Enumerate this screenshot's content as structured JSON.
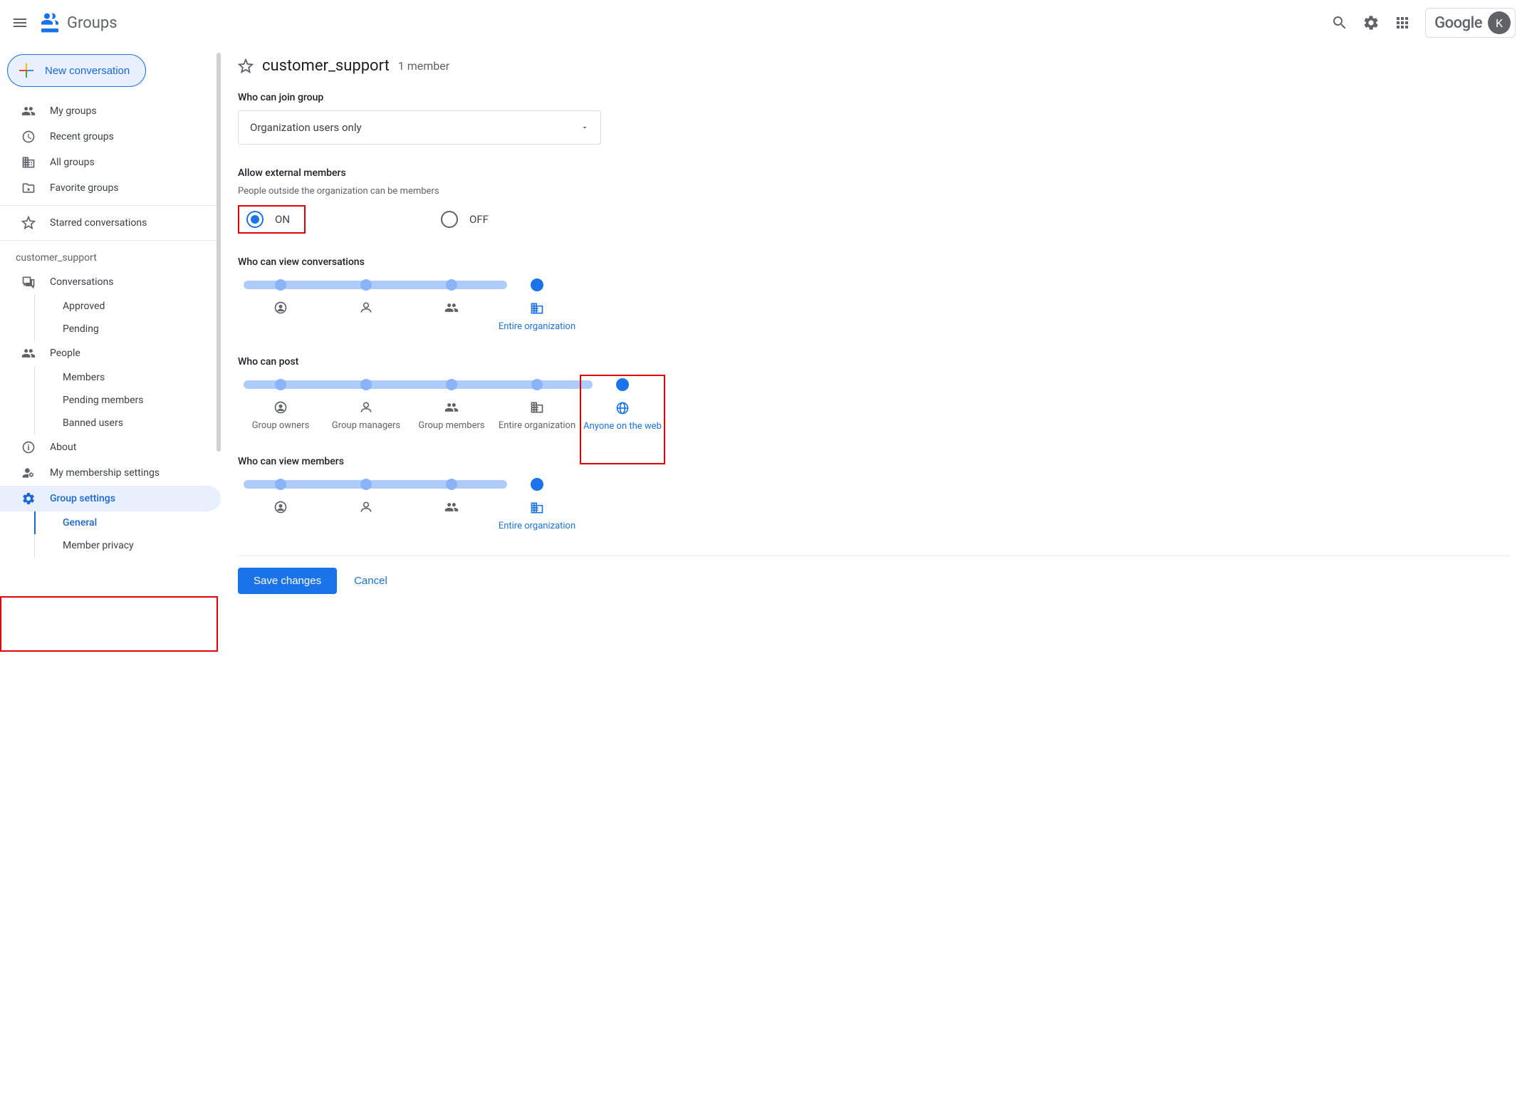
{
  "header": {
    "app_name": "Groups",
    "brand": "Google",
    "avatar_initial": "K"
  },
  "sidebar": {
    "new_conversation": "New conversation",
    "items": {
      "my_groups": "My groups",
      "recent_groups": "Recent groups",
      "all_groups": "All groups",
      "favorite_groups": "Favorite groups",
      "starred": "Starred conversations"
    },
    "group_label": "customer_support",
    "group_nav": {
      "conversations": "Conversations",
      "approved": "Approved",
      "pending": "Pending",
      "people": "People",
      "members": "Members",
      "pending_members": "Pending members",
      "banned": "Banned users",
      "about": "About",
      "membership": "My membership settings",
      "settings": "Group settings",
      "general": "General",
      "privacy": "Member privacy"
    }
  },
  "main": {
    "title": "customer_support",
    "subtitle": "1 member",
    "join": {
      "label": "Who can join group",
      "value": "Organization users only"
    },
    "external": {
      "label": "Allow external members",
      "desc": "People outside the organization can be members",
      "on": "ON",
      "off": "OFF"
    },
    "sliders": {
      "view_conv": {
        "label": "Who can view conversations",
        "selected_label": "Entire organization"
      },
      "post": {
        "label": "Who can post",
        "stops": [
          "Group owners",
          "Group managers",
          "Group members",
          "Entire organization",
          "Anyone on the web"
        ]
      },
      "view_members": {
        "label": "Who can view members",
        "selected_label": "Entire organization"
      }
    },
    "buttons": {
      "save": "Save changes",
      "cancel": "Cancel"
    }
  }
}
